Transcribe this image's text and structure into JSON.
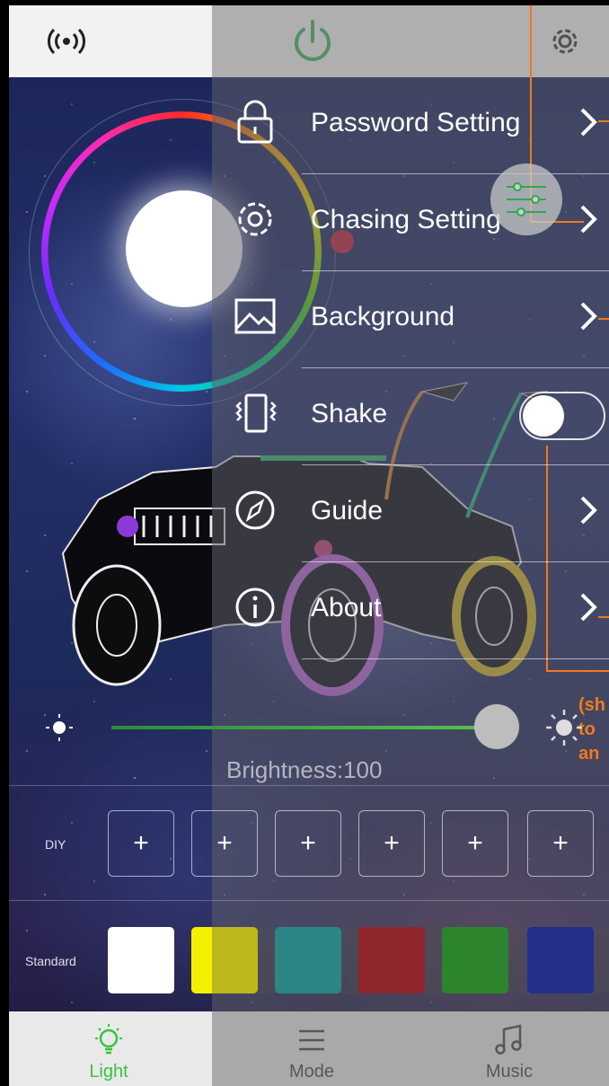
{
  "top_bar": {
    "left_icon": "broadcast-icon",
    "center_icon": "power-icon",
    "right_icon": "gear-icon",
    "power_color": "#2fa84f"
  },
  "menu": {
    "items": [
      {
        "label": "Password Setting",
        "icon": "lock-icon",
        "control": "chevron"
      },
      {
        "label": "Chasing Setting",
        "icon": "gear-icon",
        "control": "chevron"
      },
      {
        "label": "Background",
        "icon": "image-icon",
        "control": "chevron"
      },
      {
        "label": "Shake",
        "icon": "shake-phone-icon",
        "control": "toggle",
        "toggle_on": false
      },
      {
        "label": "Guide",
        "icon": "compass-icon",
        "control": "chevron"
      },
      {
        "label": "About",
        "icon": "info-icon",
        "control": "chevron"
      }
    ]
  },
  "annotation": {
    "lines": [
      "(sh",
      "to",
      "an"
    ],
    "color": "#f07a1a"
  },
  "brightness": {
    "label": "Brightness:100",
    "value": 100
  },
  "diy": {
    "label": "DIY",
    "buttons": [
      "+",
      "+",
      "+",
      "+",
      "+",
      "+"
    ]
  },
  "standard": {
    "label": "Standard",
    "colors": [
      "#ffffff",
      "#f5f000",
      "#1aa3a3",
      "#b0101a",
      "#1aa01a",
      "#0b1ea8"
    ]
  },
  "tabs": [
    {
      "label": "Light",
      "icon": "bulb-icon",
      "active": true,
      "color": "#37c43c"
    },
    {
      "label": "Mode",
      "icon": "menu-lines-icon",
      "active": false,
      "color": "#555555"
    },
    {
      "label": "Music",
      "icon": "music-note-icon",
      "active": false,
      "color": "#555555"
    }
  ]
}
